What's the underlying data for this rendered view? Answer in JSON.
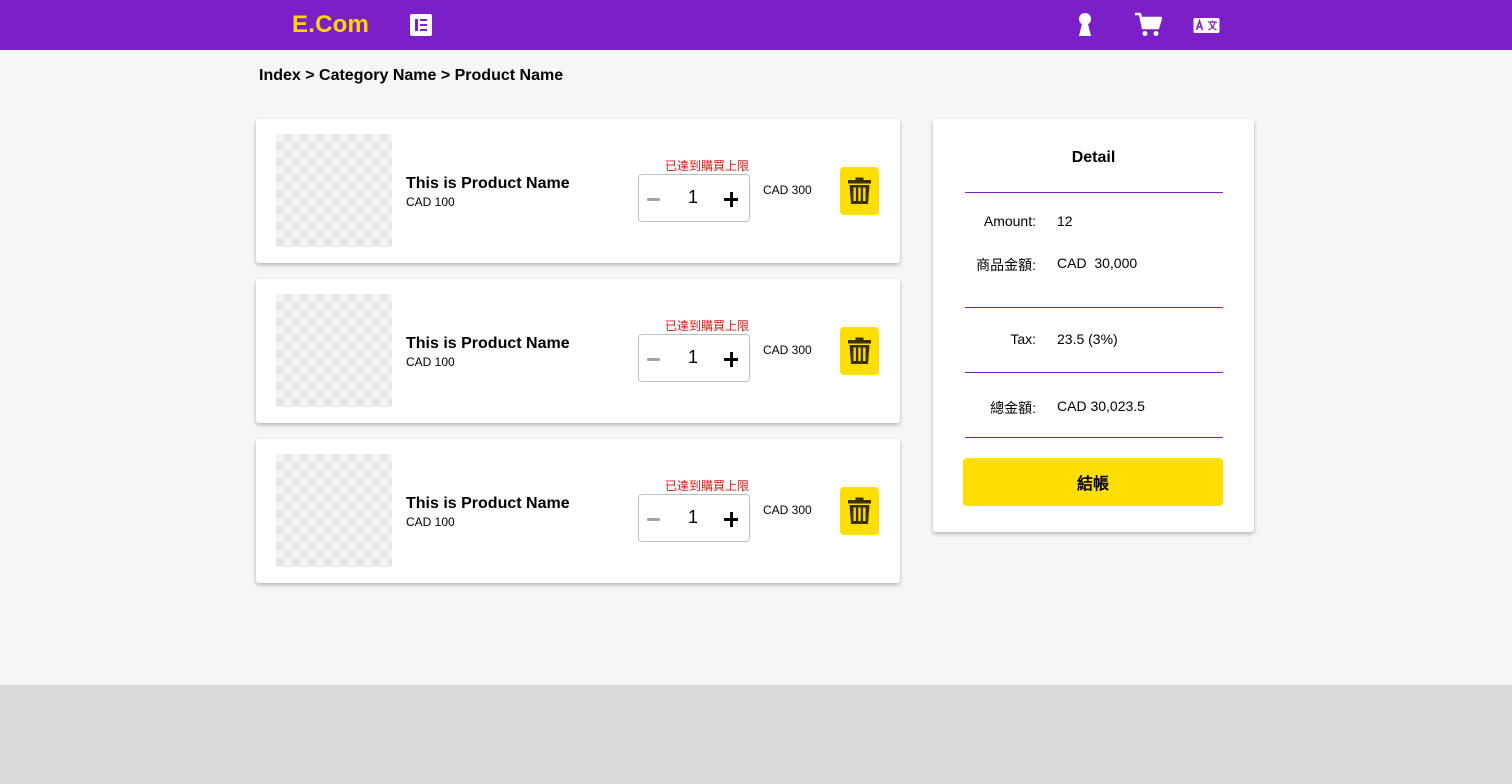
{
  "header": {
    "logo": "E.Com",
    "icons": [
      "menu-icon",
      "user-icon",
      "cart-icon",
      "translate-icon"
    ],
    "colors": {
      "bar": "#7b1fc9",
      "logo": "#ffd600"
    }
  },
  "breadcrumb": "Index > Category Name > Product Name",
  "cart": {
    "items": [
      {
        "name": "This is Product Name",
        "unit_price": "CAD 100",
        "limit_notice": "已達到購買上限",
        "quantity": "1",
        "subtotal": "CAD 300"
      },
      {
        "name": "This is Product Name",
        "unit_price": "CAD 100",
        "limit_notice": "已達到購買上限",
        "quantity": "1",
        "subtotal": "CAD 300"
      },
      {
        "name": "This is Product Name",
        "unit_price": "CAD 100",
        "limit_notice": "已達到購買上限",
        "quantity": "1",
        "subtotal": "CAD 300"
      }
    ]
  },
  "detail": {
    "title": "Detail",
    "amount_label": "Amount:",
    "amount_value": "12",
    "goods_label": "商品金額:",
    "goods_value": "CAD  30,000",
    "tax_label": "Tax:",
    "tax_value": "23.5 (3%)",
    "total_label": "總金額:",
    "total_value": "CAD 30,023.5",
    "checkout_label": "結帳"
  },
  "colors": {
    "accent": "#7b1fc9",
    "button": "#ffde00",
    "warning": "#e11414"
  }
}
